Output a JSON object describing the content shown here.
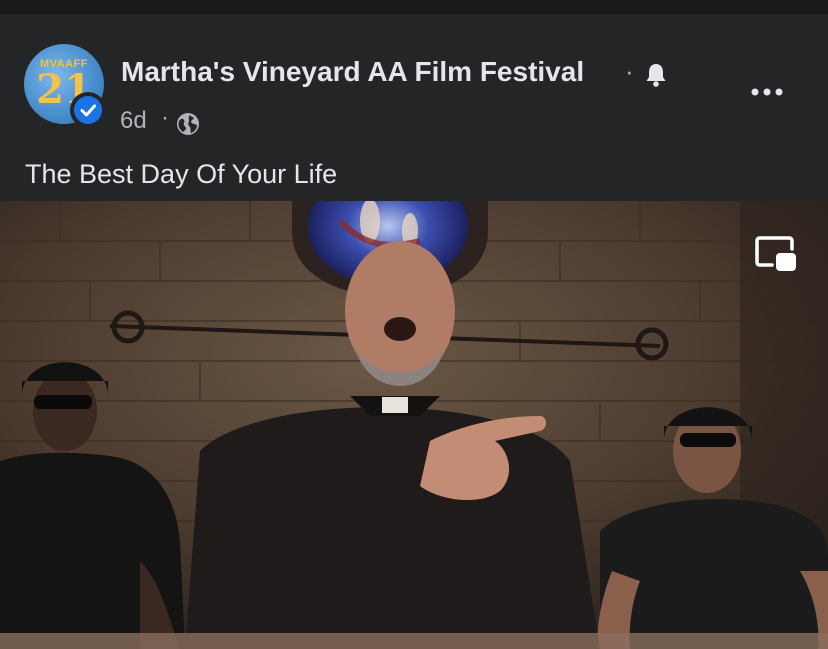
{
  "post": {
    "page_name": "Martha's Vineyard AA Film Festival",
    "avatar_text": "MVAAFF",
    "avatar_number": "21",
    "time": "6d",
    "separator": "·",
    "caption": "The Best Day Of Your Life"
  },
  "icons": {
    "verified": "verified-check-icon",
    "bell": "bell-icon",
    "globe": "globe-icon",
    "more": "more-options-icon",
    "pip": "picture-in-picture-icon"
  },
  "colors": {
    "background": "#18191a",
    "card": "#242526",
    "text_primary": "#e4e6eb",
    "text_secondary": "#b0b3b8",
    "verified_blue": "#1b74e4"
  }
}
